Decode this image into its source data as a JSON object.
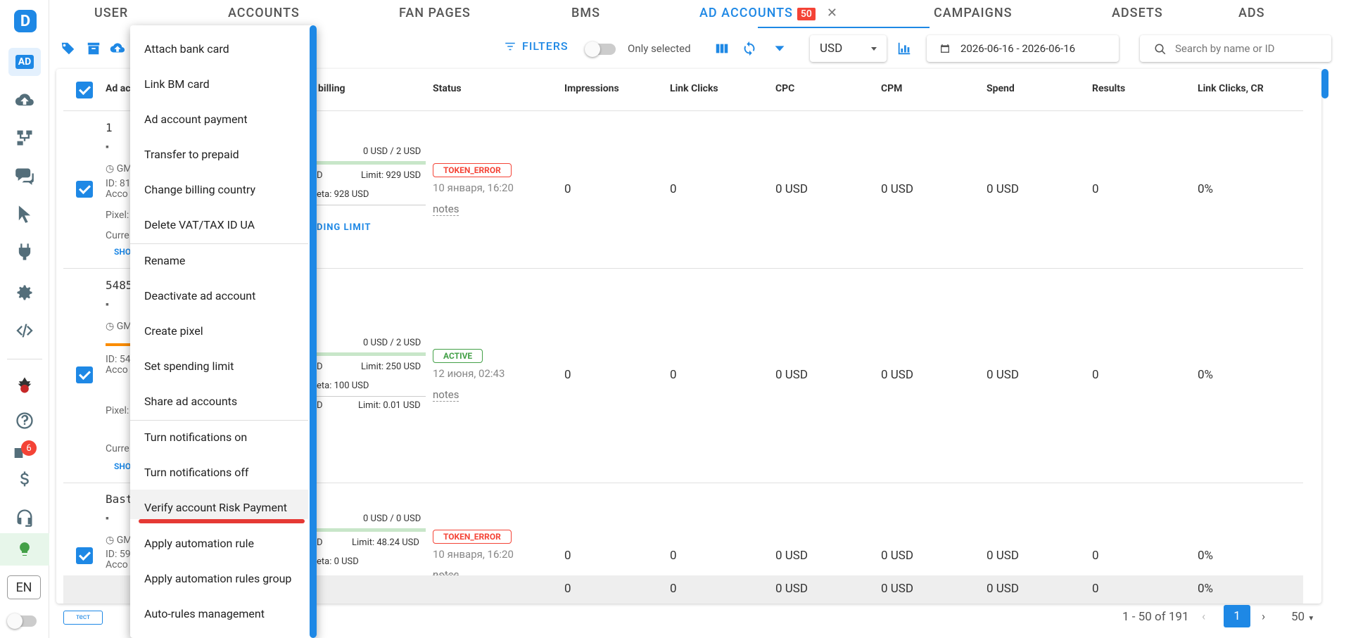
{
  "sidebar": {
    "logo": "D",
    "ad_label": "AD",
    "notif_count": "6",
    "lang": "EN"
  },
  "tabs": [
    {
      "label": "USER"
    },
    {
      "label": "ACCOUNTS"
    },
    {
      "label": "FAN PAGES"
    },
    {
      "label": "BMS"
    },
    {
      "label": "AD ACCOUNTS",
      "badge": "50"
    },
    {
      "label": "CAMPAIGNS"
    },
    {
      "label": "ADSETS"
    },
    {
      "label": "ADS"
    }
  ],
  "toolbar": {
    "filters_label": "FILTERS",
    "only_selected_label": "Only selected",
    "currency": "USD",
    "date_range": "2026-06-16 - 2026-06-16",
    "search_placeholder": "Search by name or ID"
  },
  "columns": [
    "Ad ac",
    "billing",
    "Status",
    "Impressions",
    "Link Clicks",
    "CPC",
    "CPM",
    "Spend",
    "Results",
    "Link Clicks, CR"
  ],
  "rows": [
    {
      "name": "1",
      "id_text": "ID: 81",
      "acc_text": "Acco",
      "pixel": "Pixel:",
      "currency_text": "Curre",
      "show": "SHO",
      "tz": "GM",
      "billing_top": "0 USD / 2 USD",
      "billing_d": "D",
      "limit": "Limit: 929 USD",
      "meta": "eta: 928 USD",
      "spending_limit": "DING LIMIT",
      "status": "TOKEN_ERROR",
      "status_date": "10 января, 16:20",
      "notes": "notes",
      "impressions": "0",
      "link_clicks": "0",
      "cpc": "0 USD",
      "cpm": "0 USD",
      "spend": "0 USD",
      "results": "0",
      "cr": "0%"
    },
    {
      "name": "5485",
      "id_text": "ID: 54",
      "acc_text": "Acco",
      "pixel": "Pixel:",
      "currency_text": "Curre",
      "show": "SHO",
      "tz": "GM",
      "billing_top": "0 USD / 2 USD",
      "billing_d": "D",
      "limit": "Limit: 250 USD",
      "meta": "eta: 100 USD",
      "billing_d2": "D",
      "limit2": "Limit: 0.01 USD",
      "status": "ACTIVE",
      "status_date": "12 июня, 02:43",
      "notes": "notes",
      "impressions": "0",
      "link_clicks": "0",
      "cpc": "0 USD",
      "cpm": "0 USD",
      "spend": "0 USD",
      "results": "0",
      "cr": "0%"
    },
    {
      "name": "Bast",
      "id_text": "ID: 59",
      "acc_text": "Acco",
      "tz": "GM",
      "billing_top": "0 USD / 0 USD",
      "billing_d": "D",
      "limit": "Limit: 48.24 USD",
      "meta": "eta: 0 USD",
      "status": "TOKEN_ERROR",
      "status_date": "10 января, 16:20",
      "notes": "notes",
      "impressions": "0",
      "link_clicks": "0",
      "cpc": "0 USD",
      "cpm": "0 USD",
      "spend": "0 USD",
      "results": "0",
      "cr": "0%"
    }
  ],
  "totals": {
    "impressions": "0",
    "link_clicks": "0",
    "cpc": "0 USD",
    "cpm": "0 USD",
    "spend": "0 USD",
    "results": "0",
    "cr": "0%"
  },
  "footer": {
    "chip": "тест",
    "range": "1 - 50 of 191",
    "page": "1",
    "per_page": "50"
  },
  "menu": [
    "Attach bank card",
    "Link BM card",
    "Ad account payment",
    "Transfer to prepaid",
    "Change billing country",
    "Delete VAT/TAX ID UA",
    "Rename",
    "Deactivate ad account",
    "Create pixel",
    "Set spending limit",
    "Share ad accounts",
    "Turn notifications on",
    "Turn notifications off",
    "Verify account Risk Payment",
    "Apply automation rule",
    "Apply automation rules group",
    "Auto-rules management"
  ],
  "colors": {
    "accent": "#1e88e5",
    "error": "#f44336",
    "success": "#43a047"
  }
}
